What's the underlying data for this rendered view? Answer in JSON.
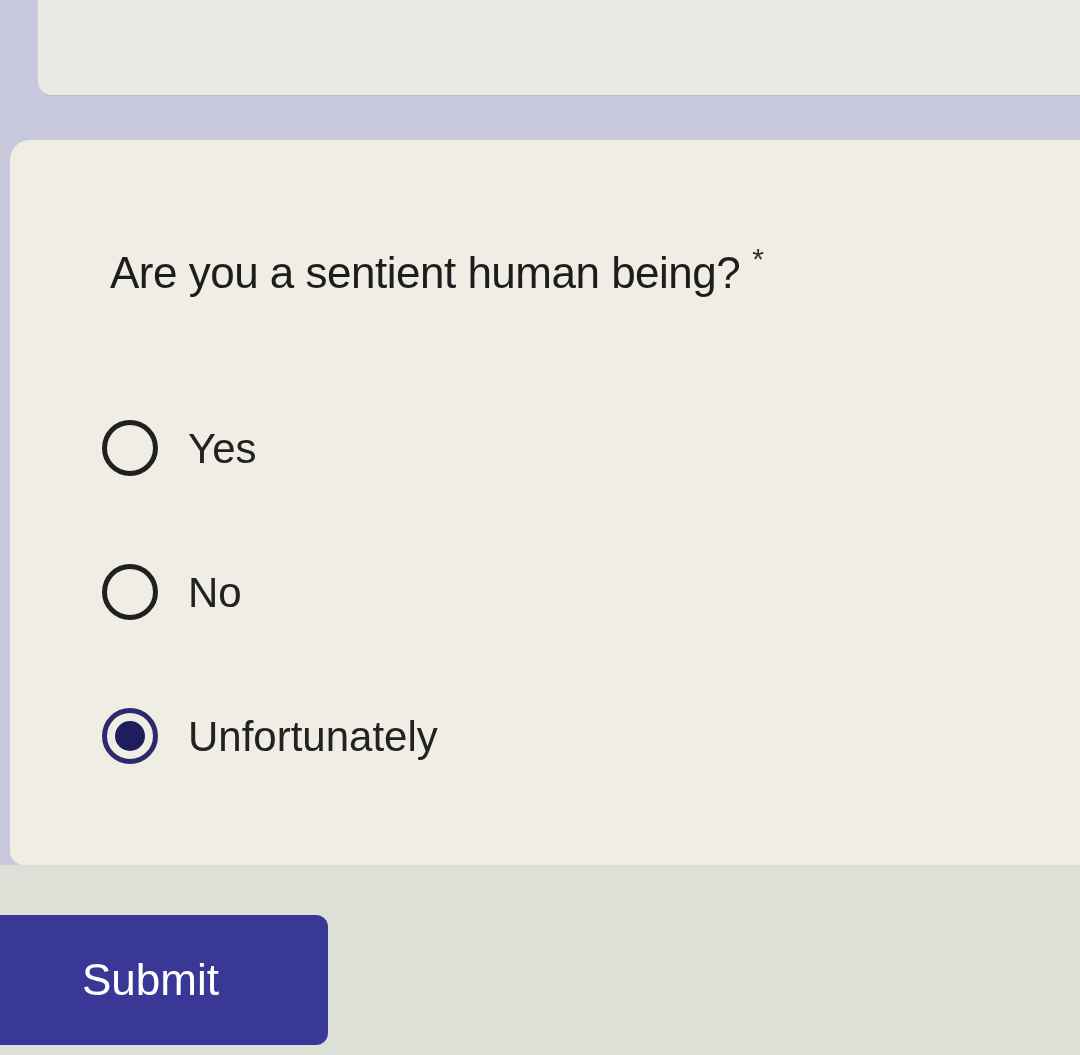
{
  "question": {
    "title": "Are you a sentient human being?",
    "required_mark": "*"
  },
  "options": [
    {
      "label": "Yes",
      "selected": false
    },
    {
      "label": "No",
      "selected": false
    },
    {
      "label": "Unfortunately",
      "selected": true
    }
  ],
  "submit": {
    "label": "Submit"
  }
}
